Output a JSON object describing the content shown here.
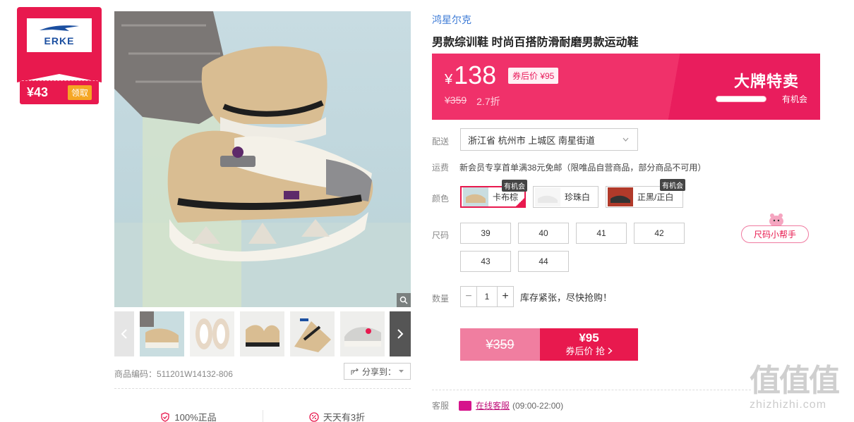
{
  "brand_badge": {
    "logo_text": "ERKE",
    "coupon_price": "¥43",
    "coupon_button": "领取"
  },
  "gallery": {
    "sku_label": "商品编码：511201W14132-806",
    "share_label": "分享到："
  },
  "guarantees": [
    "100%正品",
    "天天有3折"
  ],
  "product": {
    "brand": "鸿星尔克",
    "title": "男款综训鞋 时尚百搭防滑耐磨男款运动鞋"
  },
  "price": {
    "currency": "¥",
    "value": "138",
    "after_coupon": "券后价 ¥95",
    "original": "¥359",
    "discount": "2.7折",
    "promo_title": "大牌特卖",
    "promo_chance": "有机会"
  },
  "labels": {
    "delivery": "配送",
    "freight": "运费",
    "color": "颜色",
    "size": "尺码",
    "quantity": "数量",
    "service": "客服"
  },
  "delivery": {
    "address": "浙江省 杭州市 上城区 南星街道"
  },
  "freight_text": "新会员专享首单满38元免邮（限唯品自营商品，部分商品不可用）",
  "colors": [
    {
      "name": "卡布棕",
      "tag": "有机会"
    },
    {
      "name": "珍珠白",
      "tag": ""
    },
    {
      "name": "正黑/正白",
      "tag": "有机会"
    }
  ],
  "sizes": [
    "39",
    "40",
    "41",
    "42",
    "43",
    "44"
  ],
  "size_helper": "尺码小帮手",
  "quantity": {
    "minus": "−",
    "value": "1",
    "plus": "+"
  },
  "stock_text": "库存紧张，尽快抢购！",
  "buy": {
    "original": "¥359",
    "price": "¥95",
    "label": "券后价 抢"
  },
  "service": {
    "link": "在线客服",
    "hours": "(09:00-22:00)"
  },
  "watermark": {
    "big": "值值值",
    "small": "zhizhizhi.com"
  },
  "colors_hex": {
    "accent": "#e8194e",
    "banner": "#f0316a",
    "brand_link": "#3d7bd6"
  }
}
